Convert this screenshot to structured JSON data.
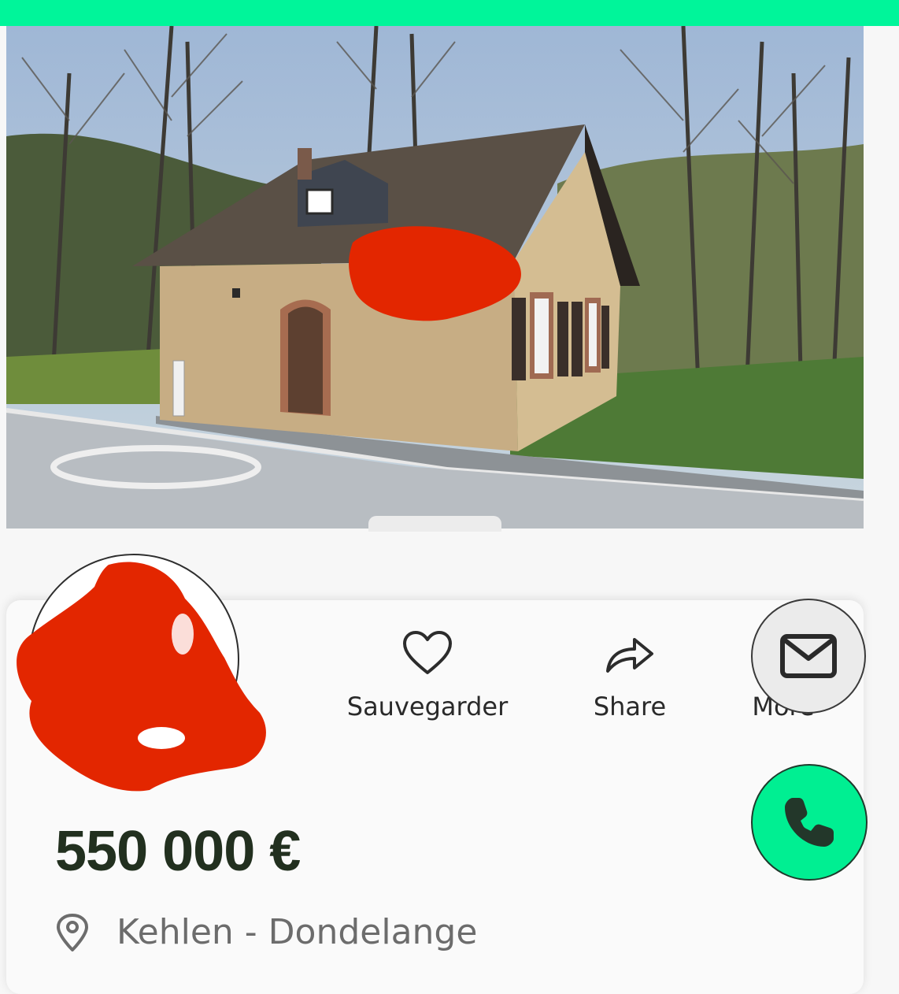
{
  "brand": {
    "accent_color": "#00f59a",
    "phone_button_color": "#00ef92",
    "redaction_color": "#e32600"
  },
  "listing": {
    "photo_alt": "Stone house with dark roof beside a road and trees",
    "price": "550 000 €",
    "location": "Kehlen - Dondelange"
  },
  "actions": {
    "save_label": "Sauvegarder",
    "share_label": "Share",
    "more_label": "More"
  },
  "icons": {
    "save": "heart-icon",
    "share": "share-arrow-icon",
    "mail": "envelope-icon",
    "phone": "phone-icon",
    "location": "location-pin-icon"
  }
}
